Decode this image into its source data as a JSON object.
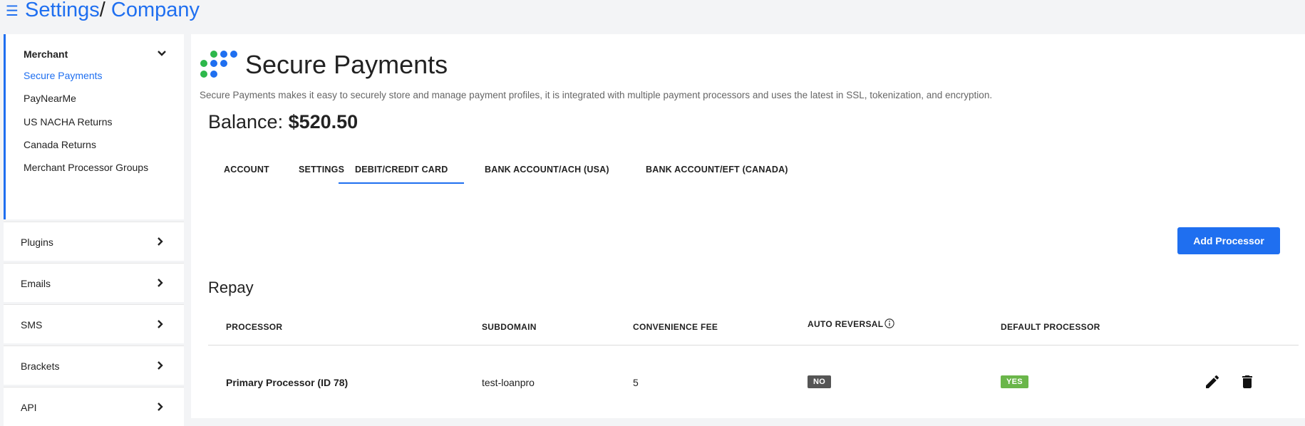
{
  "breadcrumb": {
    "root": "Settings",
    "separator": "/",
    "current": "Company"
  },
  "sidebar": {
    "merchant": {
      "label": "Merchant",
      "items": [
        "Secure Payments",
        "PayNearMe",
        "US NACHA Returns",
        "Canada Returns",
        "Merchant Processor Groups"
      ],
      "active_index": 0
    },
    "items": [
      "Plugins",
      "Emails",
      "SMS",
      "Brackets",
      "API"
    ]
  },
  "main": {
    "title": "Secure Payments",
    "description": "Secure Payments makes it easy to securely store and manage payment profiles, it is integrated with multiple payment processors and uses the latest in SSL, tokenization, and encryption.",
    "balance_label": "Balance:",
    "balance_value": "$520.50",
    "tabs": [
      "ACCOUNT",
      "SETTINGS",
      "DEBIT/CREDIT CARD",
      "BANK ACCOUNT/ACH (USA)",
      "BANK ACCOUNT/EFT (CANADA)"
    ],
    "active_tab": 2,
    "add_button": "Add Processor",
    "section_title": "Repay",
    "table": {
      "headers": [
        "PROCESSOR",
        "SUBDOMAIN",
        "CONVENIENCE FEE",
        "AUTO REVERSAL",
        "DEFAULT PROCESSOR"
      ],
      "rows": [
        {
          "processor": "Primary Processor (ID 78)",
          "subdomain": "test-loanpro",
          "convenience_fee": "5",
          "auto_reversal": "NO",
          "default_processor": "YES"
        }
      ]
    }
  },
  "colors": {
    "accent": "#1f6ff0",
    "badge_no": "#555555",
    "badge_yes": "#6ab64a",
    "logo_green": "#2db84b",
    "logo_blue": "#1f6ff0"
  },
  "icons": {
    "menu": "hamburger-icon",
    "info": "info-icon",
    "edit": "pencil-icon",
    "delete": "trash-icon",
    "chevron_down": "chevron-down-icon",
    "chevron_right": "chevron-right-icon"
  }
}
